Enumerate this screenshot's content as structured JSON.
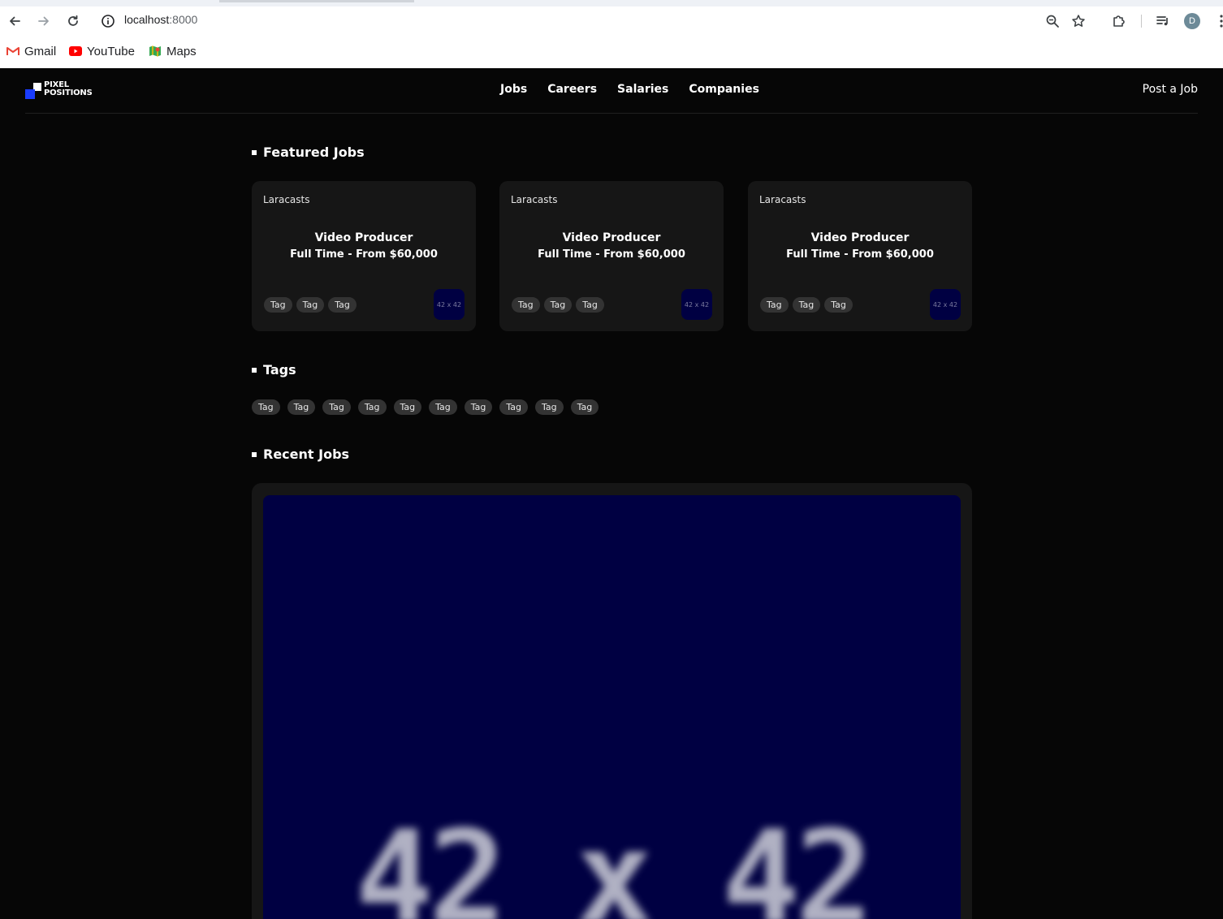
{
  "browser": {
    "url_host": "localhost",
    "url_port": ":8000",
    "profile_initial": "D",
    "bookmarks": [
      {
        "label": "Gmail",
        "icon": "gmail-icon"
      },
      {
        "label": "YouTube",
        "icon": "youtube-icon"
      },
      {
        "label": "Maps",
        "icon": "maps-icon"
      }
    ]
  },
  "site": {
    "logo_line1": "PIXEL",
    "logo_line2": "POSITIONS",
    "nav": [
      "Jobs",
      "Careers",
      "Salaries",
      "Companies"
    ],
    "post_job": "Post a Job"
  },
  "sections": {
    "featured": "Featured Jobs",
    "tags": "Tags",
    "recent": "Recent Jobs"
  },
  "featured_jobs": [
    {
      "company": "Laracasts",
      "title": "Video Producer",
      "subtitle": "Full Time - From $60,000",
      "tags": [
        "Tag",
        "Tag",
        "Tag"
      ],
      "logo": "42 x 42"
    },
    {
      "company": "Laracasts",
      "title": "Video Producer",
      "subtitle": "Full Time - From $60,000",
      "tags": [
        "Tag",
        "Tag",
        "Tag"
      ],
      "logo": "42 x 42"
    },
    {
      "company": "Laracasts",
      "title": "Video Producer",
      "subtitle": "Full Time - From $60,000",
      "tags": [
        "Tag",
        "Tag",
        "Tag"
      ],
      "logo": "42 x 42"
    }
  ],
  "all_tags": [
    "Tag",
    "Tag",
    "Tag",
    "Tag",
    "Tag",
    "Tag",
    "Tag",
    "Tag",
    "Tag",
    "Tag"
  ],
  "recent_job": {
    "image_label": "42 x 42"
  },
  "colors": {
    "page_bg": "#060606",
    "card_bg": "#161616",
    "tag_bg": "#333333",
    "placeholder_bg": "#000042",
    "logo_accent": "#1a3cff"
  }
}
